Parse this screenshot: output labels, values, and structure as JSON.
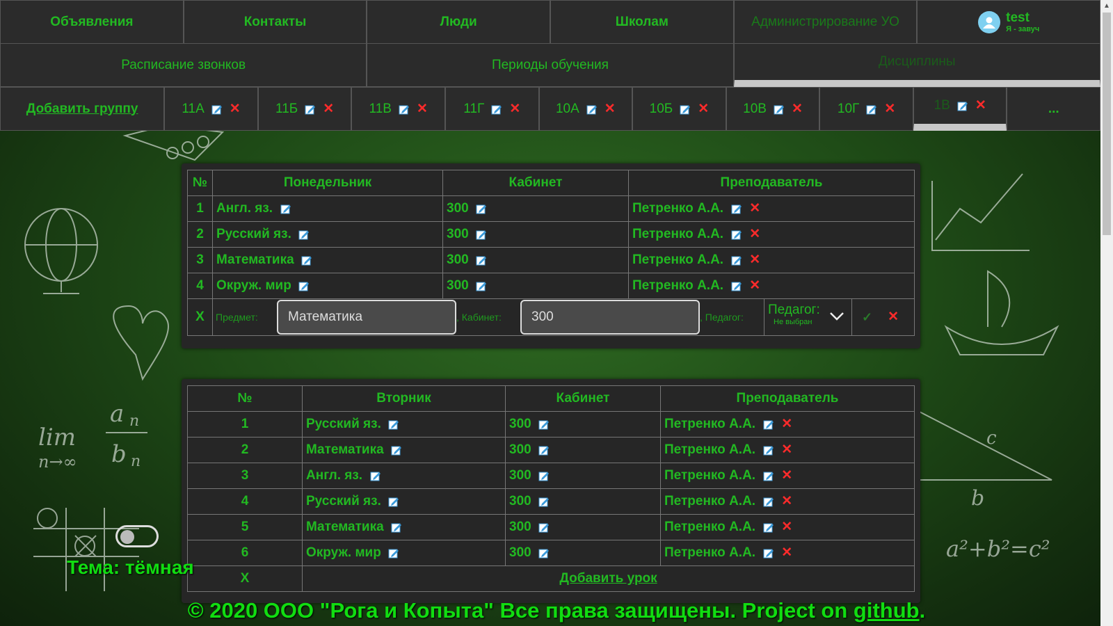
{
  "nav": {
    "row1": [
      "Объявления",
      "Контакты",
      "Люди",
      "Школам",
      "Администрирование УО"
    ],
    "user": {
      "name": "test",
      "role": "Я - завуч"
    },
    "row2": [
      "Расписание звонков",
      "Периоды обучения",
      "Дисциплины"
    ],
    "groups_add": "Добавить группу",
    "groups": [
      "11А",
      "11Б",
      "11В",
      "11Г",
      "10А",
      "10Б",
      "10В",
      "10Г",
      "1В"
    ],
    "more": "..."
  },
  "monday": {
    "headers": [
      "№",
      "Понедельник",
      "Кабинет",
      "Преподаватель"
    ],
    "rows": [
      {
        "n": "1",
        "subject": "Англ. яз.",
        "room": "300",
        "teacher": "Петренко А.А."
      },
      {
        "n": "2",
        "subject": "Русский яз.",
        "room": "300",
        "teacher": "Петренко А.А."
      },
      {
        "n": "3",
        "subject": "Математика",
        "room": "300",
        "teacher": "Петренко А.А."
      },
      {
        "n": "4",
        "subject": "Окруж. мир",
        "room": "300",
        "teacher": "Петренко А.А."
      }
    ],
    "form": {
      "marker": "X",
      "subject_label": "Предмет:",
      "subject_value": "Математика",
      "room_label": ", Кабинет:",
      "room_value": "300",
      "teacher_label": ", Педагог:",
      "teacher_select": "Педагог:",
      "teacher_selected": "Не выбран"
    }
  },
  "tuesday": {
    "headers": [
      "№",
      "Вторник",
      "Кабинет",
      "Преподаватель"
    ],
    "rows": [
      {
        "n": "1",
        "subject": "Русский яз.",
        "room": "300",
        "teacher": "Петренко А.А."
      },
      {
        "n": "2",
        "subject": "Математика",
        "room": "300",
        "teacher": "Петренко А.А."
      },
      {
        "n": "3",
        "subject": "Англ. яз.",
        "room": "300",
        "teacher": "Петренко А.А."
      },
      {
        "n": "4",
        "subject": "Русский яз.",
        "room": "300",
        "teacher": "Петренко А.А."
      },
      {
        "n": "5",
        "subject": "Математика",
        "room": "300",
        "teacher": "Петренко А.А."
      },
      {
        "n": "6",
        "subject": "Окруж. мир",
        "room": "300",
        "teacher": "Петренко А.А."
      }
    ],
    "footer_marker": "X",
    "add_lesson": "Добавить урок"
  },
  "theme": {
    "label": "Тема: тёмная"
  },
  "footer": {
    "text": "© 2020 ООО \"Рога и Копыта\" Все права защищены. Project on ",
    "link": "github",
    "end": "."
  },
  "colors": {
    "accent": "#22b922",
    "panel": "#262626",
    "delete": "#ff2b2b",
    "edit": "#3a9ad9"
  }
}
